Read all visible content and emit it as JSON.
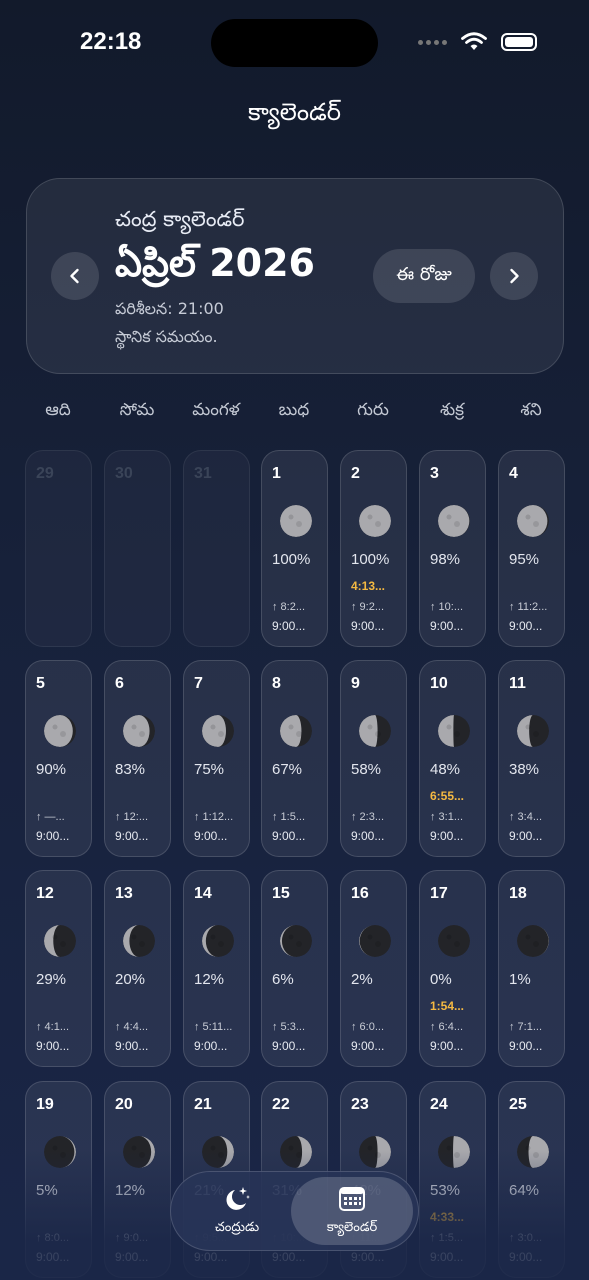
{
  "status": {
    "time": "22:18"
  },
  "header": {
    "title": "క్యాలెండర్"
  },
  "month_card": {
    "subtitle": "చంద్ర క్యాలెండర్",
    "month": "ఏప్రిల్ 2026",
    "observation": "పరిశీలన: 21:00",
    "local_time": "స్థానిక సమయం.",
    "today_label": "ఈ రోజు"
  },
  "weekdays": [
    "ఆది",
    "సోమ",
    "మంగళ",
    "బుధ",
    "గురు",
    "శుక్ర",
    "శని"
  ],
  "days": [
    {
      "day": "29",
      "faded": true
    },
    {
      "day": "30",
      "faded": true
    },
    {
      "day": "31",
      "faded": true
    },
    {
      "day": "1",
      "illum": "100%",
      "event": "",
      "rise": "↑ 8:2...",
      "set": "9:00...",
      "illum_value": 1.0,
      "waxing": false
    },
    {
      "day": "2",
      "illum": "100%",
      "event": "4:13...",
      "rise": "↑ 9:2...",
      "set": "9:00...",
      "illum_value": 1.0,
      "waxing": false
    },
    {
      "day": "3",
      "illum": "98%",
      "event": "",
      "rise": "↑ 10:...",
      "set": "9:00...",
      "illum_value": 0.98,
      "waxing": false
    },
    {
      "day": "4",
      "illum": "95%",
      "event": "",
      "rise": "↑ 11:2...",
      "set": "9:00...",
      "illum_value": 0.95,
      "waxing": false
    },
    {
      "day": "5",
      "illum": "90%",
      "event": "",
      "rise": "↑ —...",
      "set": "9:00...",
      "illum_value": 0.9,
      "waxing": false
    },
    {
      "day": "6",
      "illum": "83%",
      "event": "",
      "rise": "↑ 12:...",
      "set": "9:00...",
      "illum_value": 0.83,
      "waxing": false
    },
    {
      "day": "7",
      "illum": "75%",
      "event": "",
      "rise": "↑ 1:12...",
      "set": "9:00...",
      "illum_value": 0.75,
      "waxing": false
    },
    {
      "day": "8",
      "illum": "67%",
      "event": "",
      "rise": "↑ 1:5...",
      "set": "9:00...",
      "illum_value": 0.67,
      "waxing": false
    },
    {
      "day": "9",
      "illum": "58%",
      "event": "",
      "rise": "↑ 2:3...",
      "set": "9:00...",
      "illum_value": 0.58,
      "waxing": false
    },
    {
      "day": "10",
      "illum": "48%",
      "event": "6:55...",
      "rise": "↑ 3:1...",
      "set": "9:00...",
      "illum_value": 0.48,
      "waxing": false
    },
    {
      "day": "11",
      "illum": "38%",
      "event": "",
      "rise": "↑ 3:4...",
      "set": "9:00...",
      "illum_value": 0.38,
      "waxing": false
    },
    {
      "day": "12",
      "illum": "29%",
      "event": "",
      "rise": "↑ 4:1...",
      "set": "9:00...",
      "illum_value": 0.29,
      "waxing": false
    },
    {
      "day": "13",
      "illum": "20%",
      "event": "",
      "rise": "↑ 4:4...",
      "set": "9:00...",
      "illum_value": 0.2,
      "waxing": false
    },
    {
      "day": "14",
      "illum": "12%",
      "event": "",
      "rise": "↑ 5:11...",
      "set": "9:00...",
      "illum_value": 0.12,
      "waxing": false
    },
    {
      "day": "15",
      "illum": "6%",
      "event": "",
      "rise": "↑ 5:3...",
      "set": "9:00...",
      "illum_value": 0.06,
      "waxing": false
    },
    {
      "day": "16",
      "illum": "2%",
      "event": "",
      "rise": "↑ 6:0...",
      "set": "9:00...",
      "illum_value": 0.02,
      "waxing": false
    },
    {
      "day": "17",
      "illum": "0%",
      "event": "1:54...",
      "rise": "↑ 6:4...",
      "set": "9:00...",
      "illum_value": 0.0,
      "waxing": true
    },
    {
      "day": "18",
      "illum": "1%",
      "event": "",
      "rise": "↑ 7:1...",
      "set": "9:00...",
      "illum_value": 0.01,
      "waxing": true
    },
    {
      "day": "19",
      "illum": "5%",
      "event": "",
      "rise": "↑ 8:0...",
      "set": "9:00...",
      "illum_value": 0.05,
      "waxing": true
    },
    {
      "day": "20",
      "illum": "12%",
      "event": "",
      "rise": "↑ 9:0...",
      "set": "9:00...",
      "illum_value": 0.12,
      "waxing": true
    },
    {
      "day": "21",
      "illum": "21%",
      "event": "",
      "rise": "↑ 9:5...",
      "set": "9:00...",
      "illum_value": 0.21,
      "waxing": true
    },
    {
      "day": "22",
      "illum": "31%",
      "event": "",
      "rise": "↑ 10:...",
      "set": "9:00...",
      "illum_value": 0.31,
      "waxing": true
    },
    {
      "day": "23",
      "illum": "42%",
      "event": "",
      "rise": "↑ 11:...",
      "set": "9:00...",
      "illum_value": 0.42,
      "waxing": true
    },
    {
      "day": "24",
      "illum": "53%",
      "event": "4:33...",
      "rise": "↑ 1:5...",
      "set": "9:00...",
      "illum_value": 0.53,
      "waxing": true
    },
    {
      "day": "25",
      "illum": "64%",
      "event": "",
      "rise": "↑ 3:0...",
      "set": "9:00...",
      "illum_value": 0.64,
      "waxing": true
    }
  ],
  "tabs": [
    {
      "label": "చంద్రుడు",
      "icon": "moon-stars-icon",
      "active": false
    },
    {
      "label": "క్యాలెండర్",
      "icon": "calendar-icon",
      "active": true
    }
  ],
  "colors": {
    "event": "#f4b942",
    "moon_lit": "#a9a9ad",
    "moon_dark": "#232428"
  }
}
